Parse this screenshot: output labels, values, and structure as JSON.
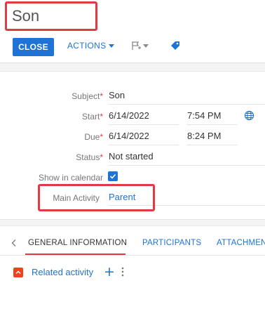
{
  "header": {
    "title": "Son",
    "close_label": "CLOSE",
    "actions_label": "ACTIONS"
  },
  "icons": {
    "flag": "flag-icon",
    "tag": "tag-icon",
    "globe": "globe-icon",
    "check": "check-icon",
    "collapse": "chevron-up-icon",
    "more": "more-vertical-icon",
    "tabs_left": "chevron-left-icon"
  },
  "colors": {
    "accent": "#1e73d4",
    "highlight_outline": "#e03b45",
    "required": "#e03b45",
    "tab_active_underline": "#e03b45",
    "detail_toggle": "#f0421c"
  },
  "form": {
    "subject_label": "Subject",
    "subject_value": "Son",
    "start_label": "Start",
    "start_date": "6/14/2022",
    "start_time": "7:54 PM",
    "due_label": "Due",
    "due_date": "6/14/2022",
    "due_time": "8:24 PM",
    "status_label": "Status",
    "status_value": "Not started",
    "show_in_calendar_label": "Show in calendar",
    "show_in_calendar_checked": true,
    "main_activity_label": "Main Activity",
    "main_activity_value": "Parent",
    "required_mark": "*"
  },
  "tabs": [
    {
      "label": "GENERAL INFORMATION",
      "active": true
    },
    {
      "label": "PARTICIPANTS",
      "active": false
    },
    {
      "label": "ATTACHMENTS",
      "active": false
    }
  ],
  "detail": {
    "related_label": "Related activity",
    "add_symbol": "+"
  }
}
